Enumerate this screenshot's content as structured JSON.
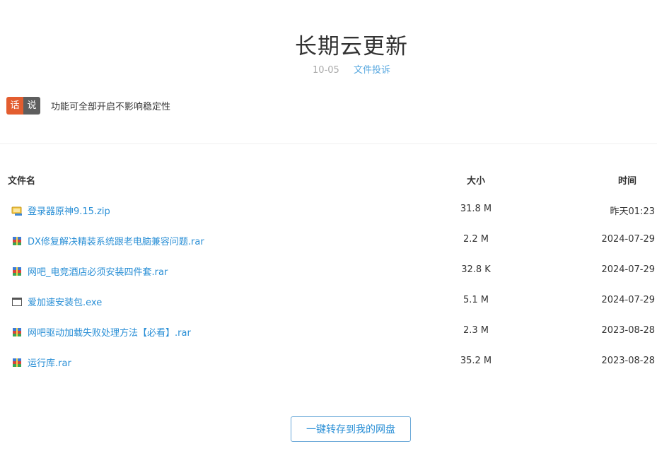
{
  "page": {
    "title": "长期云更新",
    "date": "10-05",
    "report_link": "文件投诉"
  },
  "notice": {
    "tag_left": "话",
    "tag_right": "说",
    "text": "功能可全部开启不影响稳定性"
  },
  "table": {
    "headers": {
      "name": "文件名",
      "size": "大小",
      "time": "时间"
    },
    "rows": [
      {
        "icon": "zip-icon",
        "name": "登录器原神9.15.zip",
        "size": "31.8 M",
        "time": "昨天01:23"
      },
      {
        "icon": "rar-icon",
        "name": "DX修复解决精装系统跟老电脑兼容问题.rar",
        "size": "2.2 M",
        "time": "2024-07-29"
      },
      {
        "icon": "rar-icon",
        "name": "网吧_电竞酒店必须安装四件套.rar",
        "size": "32.8 K",
        "time": "2024-07-29"
      },
      {
        "icon": "exe-icon",
        "name": "爱加速安装包.exe",
        "size": "5.1 M",
        "time": "2024-07-29"
      },
      {
        "icon": "rar-icon",
        "name": "网吧驱动加载失败处理方法【必看】.rar",
        "size": "2.3 M",
        "time": "2023-08-28"
      },
      {
        "icon": "rar-icon",
        "name": "运行库.rar",
        "size": "35.2 M",
        "time": "2023-08-28"
      }
    ]
  },
  "actions": {
    "save_button": "一键转存到我的网盘"
  }
}
